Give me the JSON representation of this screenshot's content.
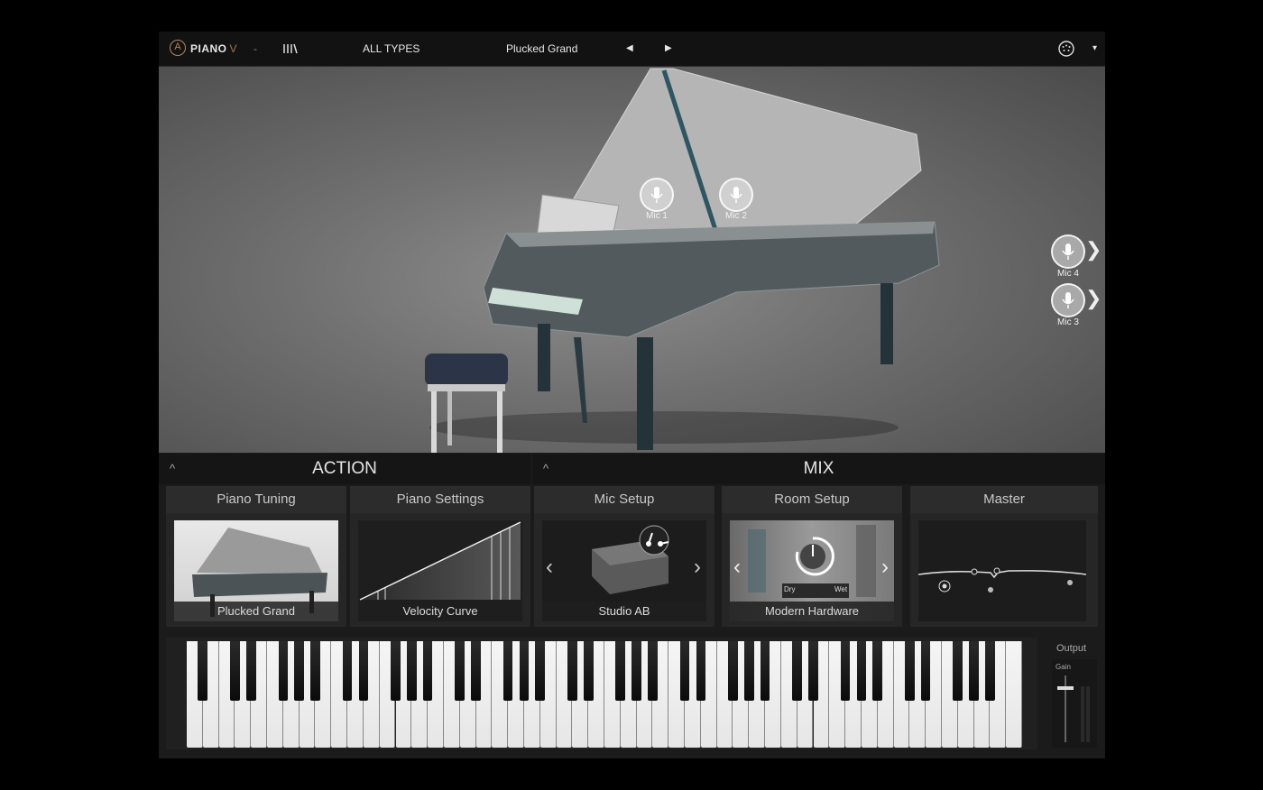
{
  "topbar": {
    "logo_symbol": "A",
    "app_name": "PIANO",
    "app_version": "V",
    "dash": "-",
    "library_icon": "library-icon",
    "types_label": "ALL TYPES",
    "preset_name": "Plucked Grand",
    "prev_icon": "◀",
    "next_icon": "▶",
    "midi_icon": "midi-icon",
    "menu_icon": "▾"
  },
  "stage": {
    "mics": [
      {
        "label": "Mic 1"
      },
      {
        "label": "Mic 2"
      },
      {
        "label": "Mic 4"
      },
      {
        "label": "Mic 3"
      }
    ],
    "chevron": "❯"
  },
  "sections": {
    "action": {
      "title": "ACTION",
      "caret": "^"
    },
    "mix": {
      "title": "MIX",
      "caret": "^"
    }
  },
  "cards": [
    {
      "title": "Piano Tuning",
      "label": "Plucked Grand"
    },
    {
      "title": "Piano Settings",
      "label": "Velocity Curve"
    },
    {
      "title": "Mic Setup",
      "label": "Studio AB",
      "prev": "‹",
      "next": "›"
    },
    {
      "title": "Room Setup",
      "label": "Modern Hardware",
      "prev": "‹",
      "next": "›",
      "dry": "Dry",
      "wet": "Wet"
    },
    {
      "title": "Master",
      "label": ""
    }
  ],
  "output": {
    "title": "Output",
    "gain_label": "Gain"
  },
  "colors": {
    "accent": "#b8865a",
    "background": "#1b1b1b"
  }
}
